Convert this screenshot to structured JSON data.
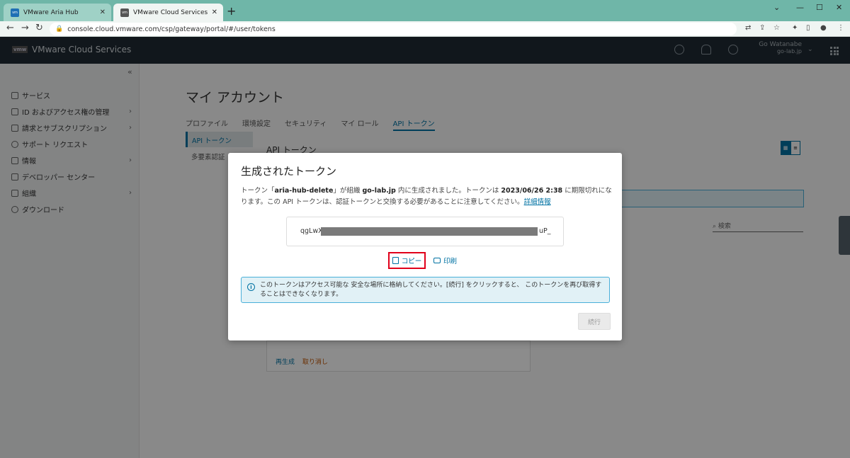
{
  "browser": {
    "tabs": [
      {
        "title": "VMware Aria Hub"
      },
      {
        "title": "VMware Cloud Services"
      }
    ],
    "url": "console.cloud.vmware.com/csp/gateway/portal/#/user/tokens"
  },
  "app": {
    "logo": "vmw",
    "title": "VMware Cloud Services",
    "user_name": "Go Watanabe",
    "user_org": "go-lab.jp"
  },
  "sidebar": {
    "items": [
      {
        "label": "サービス",
        "chevron": false
      },
      {
        "label": "ID およびアクセス権の管理",
        "chevron": true
      },
      {
        "label": "請求とサブスクリプション",
        "chevron": true
      },
      {
        "label": "サポート リクエスト",
        "chevron": false
      },
      {
        "label": "情報",
        "chevron": true
      },
      {
        "label": "デベロッパー センター",
        "chevron": false
      },
      {
        "label": "組織",
        "chevron": true
      },
      {
        "label": "ダウンロード",
        "chevron": false
      }
    ]
  },
  "page": {
    "title": "マイ アカウント",
    "tabs": [
      "プロファイル",
      "環境設定",
      "セキュリティ",
      "マイ ロール",
      "API トークン"
    ],
    "active_tab": "API トークン",
    "subnav": [
      "API トークン",
      "多要素認証"
    ],
    "section_title": "API トークン",
    "view_toggle": [
      "▦",
      "≡"
    ],
    "search_placeholder": "検索",
    "card_action_regen": "再生成",
    "card_action_revoke": "取り消し"
  },
  "modal": {
    "title": "生成されたトークン",
    "desc_1": "トークン「",
    "token_name": "aria-hub-delete",
    "desc_2": "」が組織 ",
    "org": "go-lab.jp",
    "desc_3": " 内に生成されました。トークンは ",
    "expiry": "2023/06/26 2:38",
    "desc_4": " に期限切れになります。この API トークンは、認証トークンと交換する必要があることに注意してください。",
    "details_link": "詳細情報",
    "token_prefix": "qgLwX",
    "token_suffix": "uP_",
    "copy_label": "コピー",
    "print_label": "印刷",
    "info_text": "このトークンはアクセス可能な 安全な場所に格納してください。[続行] をクリックすると、 このトークンを再び取得することはできなくなります。",
    "continue_label": "続行"
  }
}
